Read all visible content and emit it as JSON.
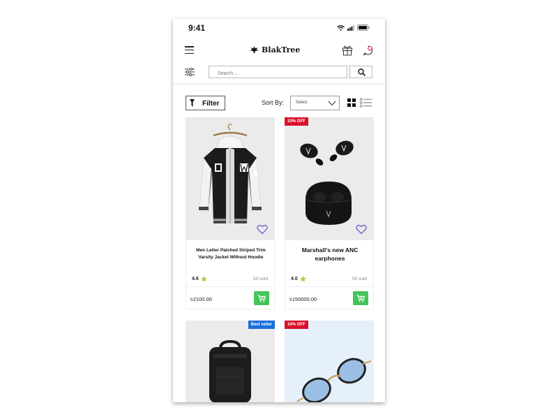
{
  "status_bar": {
    "time": "9:41"
  },
  "header": {
    "logo_text": "BlakTree"
  },
  "search": {
    "placeholder": "Search...."
  },
  "toolbar": {
    "filter_label": "Filter",
    "sort_label": "Sort By:",
    "sort_selected": "Select"
  },
  "products": [
    {
      "name": "Men Letter Patched Striped Trim Varsity Jacket Without Hoodie",
      "rating": "4.6",
      "sold": "50 sold",
      "price": "৳2100.00",
      "badge": ""
    },
    {
      "name": "Marshall's new ANC earphones",
      "rating": "4.0",
      "sold": "50 sold",
      "price": "৳150000.00",
      "badge": "10% OFF"
    },
    {
      "name": "",
      "rating": "",
      "sold": "",
      "price": "",
      "badge": "Best seller"
    },
    {
      "name": "",
      "rating": "",
      "sold": "",
      "price": "",
      "badge": "10% OFF"
    }
  ],
  "colors": {
    "accent_red": "#d8112c",
    "accent_blue": "#1d6ed8",
    "cart_green": "#46c35a",
    "heart_purple": "#6a5ad6",
    "star_green": "#a8c93a"
  },
  "icons": [
    "menu-icon",
    "gift-icon",
    "chat-icon",
    "filter-sliders-icon",
    "search-icon",
    "funnel-icon",
    "chevron-down-icon",
    "grid-view-icon",
    "list-view-icon",
    "heart-icon",
    "star-icon",
    "cart-icon",
    "wifi-icon",
    "signal-icon",
    "battery-icon"
  ]
}
